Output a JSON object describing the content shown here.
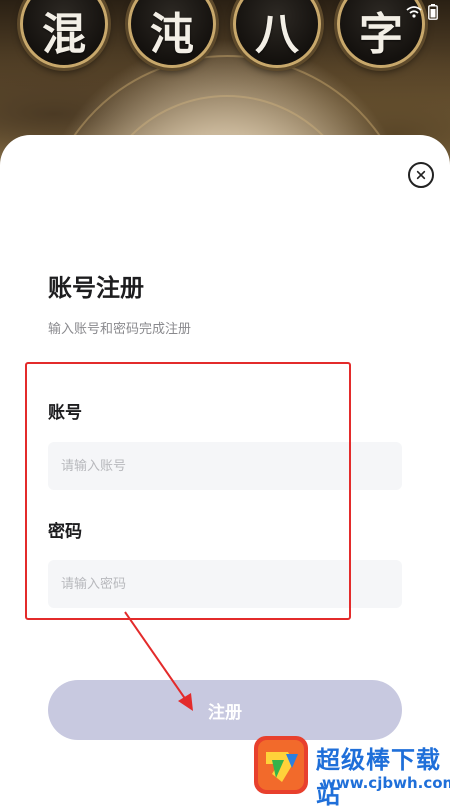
{
  "banner": {
    "characters": [
      "混",
      "沌",
      "八",
      "字"
    ]
  },
  "form": {
    "title": "账号注册",
    "subtitle": "输入账号和密码完成注册",
    "account_label": "账号",
    "account_placeholder": "请输入账号",
    "account_value": "",
    "password_label": "密码",
    "password_placeholder": "请输入密码",
    "password_value": "",
    "register_label": "注册"
  },
  "icons": {
    "close": "close-icon",
    "wifi": "wifi-icon",
    "battery": "battery-icon"
  },
  "annotation": {
    "highlight_color": "#e32b2b"
  },
  "watermark": {
    "name": "超级棒下载站",
    "url": "www.cjbwh.com"
  },
  "colors": {
    "button_disabled": "#c8c9e0",
    "input_bg": "#f5f6f8",
    "watermark_blue": "#1f6fd9"
  }
}
